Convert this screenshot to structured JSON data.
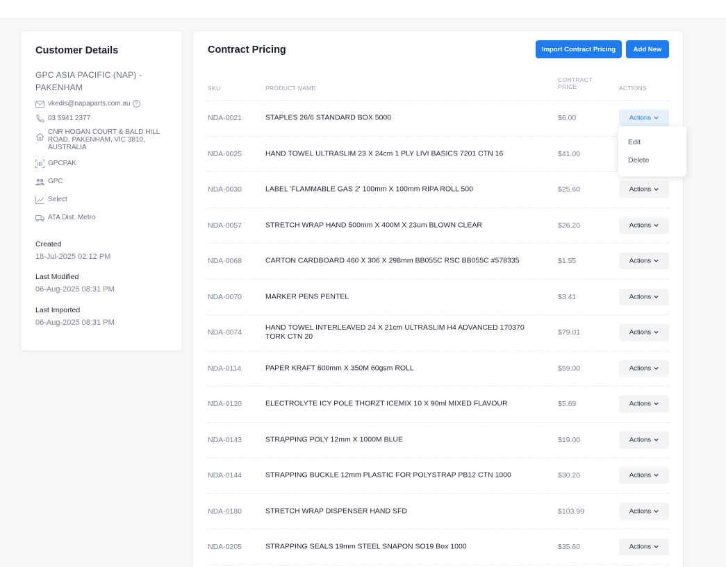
{
  "customer": {
    "title": "Customer Details",
    "company_line1": "GPC ASIA PACIFIC (NAP) -",
    "company_line2": "PAKENHAM",
    "email": "vkedis@napaparts.com.au",
    "phone": "03 5941 2377",
    "address": "CNR HOGAN COURT & BALD HILL ROAD, PAKENHAM, VIC 3810, AUSTRALIA",
    "code": "GPCPAK",
    "group": "GPC",
    "tier": "Select",
    "delivery": "ATA Dist. Metro",
    "created_label": "Created",
    "created_value": "18-Jul-2025 02:12 PM",
    "modified_label": "Last Modified",
    "modified_value": "06-Aug-2025 08:31 PM",
    "imported_label": "Last Imported",
    "imported_value": "06-Aug-2025 08:31 PM"
  },
  "pricing": {
    "title": "Contract Pricing",
    "import_label": "Import Contract Pricing",
    "add_label": "Add New",
    "columns": {
      "sku": "SKU",
      "name": "PRODUCT NAME",
      "price_line1": "CONTRACT",
      "price_line2": "PRICE",
      "actions": "ACTIONS"
    },
    "action_label": "Actions",
    "rows": [
      {
        "sku": "NDA-0021",
        "name": "STAPLES 26/6 STANDARD BOX 5000",
        "price": "$6.00"
      },
      {
        "sku": "NDA-0025",
        "name": "HAND TOWEL ULTRASLIM 23 X 24cm 1 PLY LIVI BASICS 7201 CTN 16",
        "price": "$41.00"
      },
      {
        "sku": "NDA-0030",
        "name": "LABEL 'FLAMMABLE GAS 2' 100mm X 100mm RIPA ROLL 500",
        "price": "$25.60"
      },
      {
        "sku": "NDA-0057",
        "name": "STRETCH WRAP HAND 500mm X 400M X 23um BLOWN CLEAR",
        "price": "$26.20"
      },
      {
        "sku": "NDA-0068",
        "name": "CARTON CARDBOARD 460 X 306 X 298mm BB055C RSC BB055C #578335",
        "price": "$1.55"
      },
      {
        "sku": "NDA-0070",
        "name": "MARKER PENS PENTEL",
        "price": "$3.41"
      },
      {
        "sku": "NDA-0074",
        "name": "HAND TOWEL INTERLEAVED 24 X 21cm ULTRASLIM H4 ADVANCED 170370 TORK CTN 20",
        "price": "$79.01"
      },
      {
        "sku": "NDA-0114",
        "name": "PAPER KRAFT 600mm X 350M 60gsm ROLL",
        "price": "$59.00"
      },
      {
        "sku": "NDA-0120",
        "name": "ELECTROLYTE ICY POLE THORZT ICEMIX 10 X 90ml MIXED FLAVOUR",
        "price": "$5.69"
      },
      {
        "sku": "NDA-0143",
        "name": "STRAPPING POLY 12mm X 1000M BLUE",
        "price": "$19.00"
      },
      {
        "sku": "NDA-0144",
        "name": "STRAPPING BUCKLE 12mm PLASTIC FOR POLYSTRAP PB12 CTN 1000",
        "price": "$30.20"
      },
      {
        "sku": "NDA-0180",
        "name": "STRETCH WRAP DISPENSER HAND SFD",
        "price": "$103.99"
      },
      {
        "sku": "NDA-0205",
        "name": "STRAPPING SEALS 19mm STEEL SNAPON SO19 Box 1000",
        "price": "$35.60"
      }
    ],
    "menu": {
      "edit": "Edit",
      "delete": "Delete"
    }
  },
  "colors": {
    "primary": "#1e7cf2",
    "active_bg": "#e7f0fd",
    "page_bg": "#f7f7f8"
  }
}
